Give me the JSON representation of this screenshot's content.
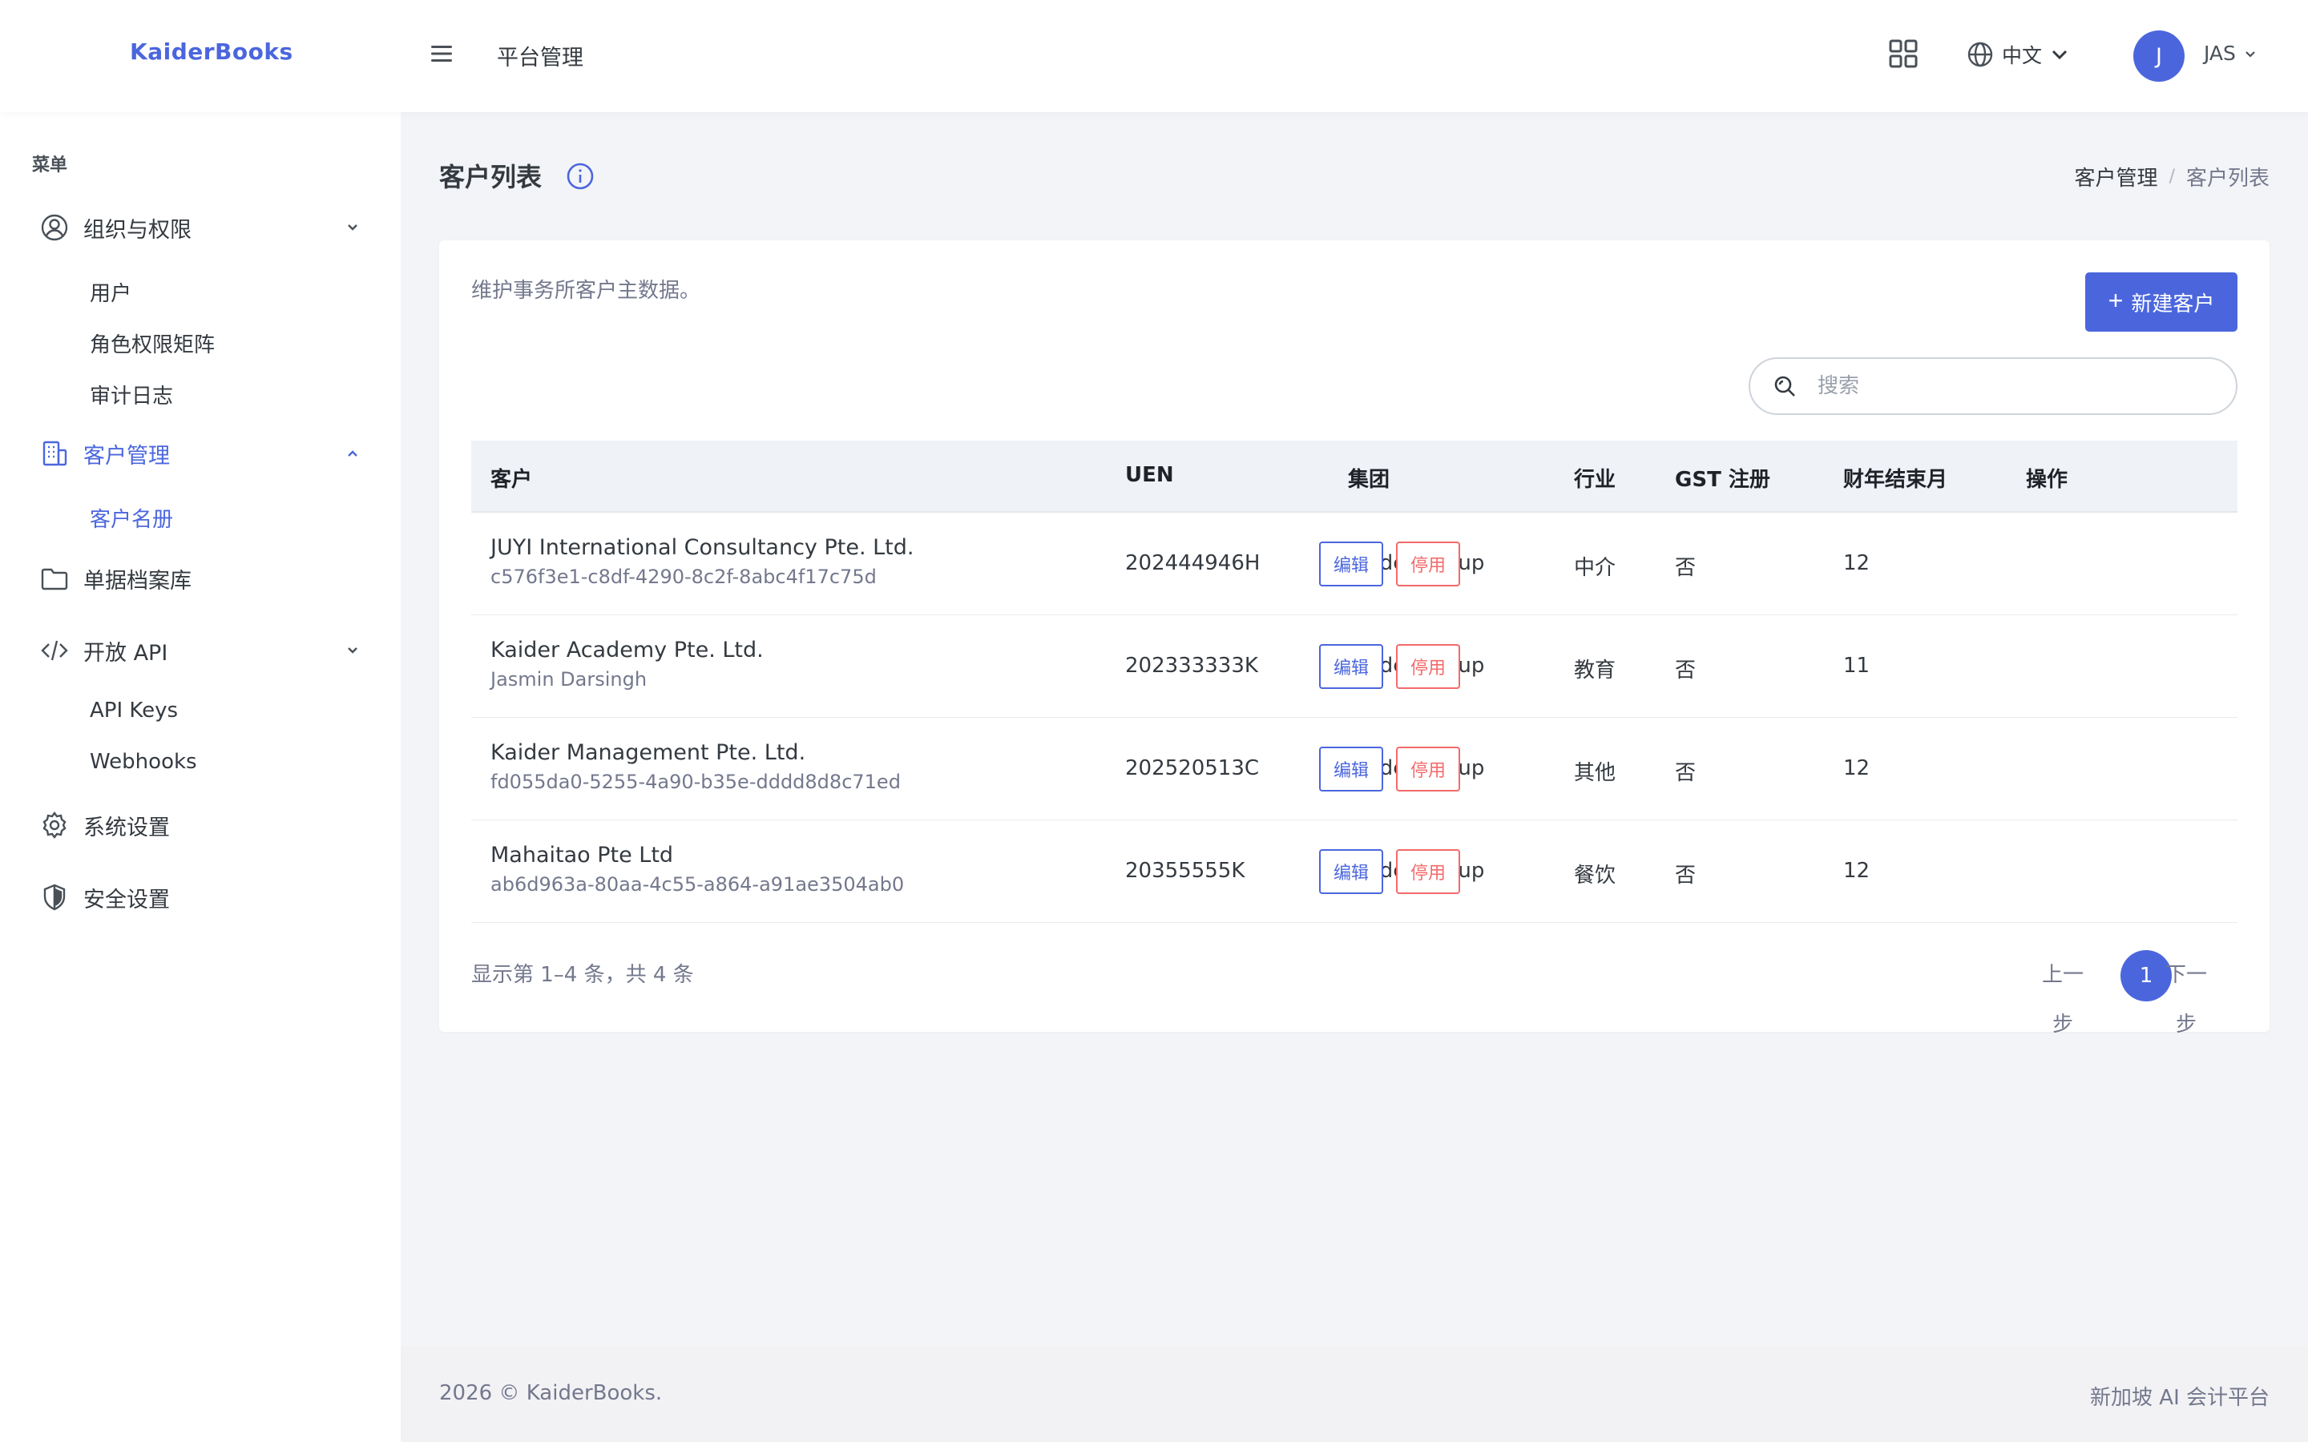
{
  "header": {
    "logo": "KaiderBooks",
    "title": "平台管理",
    "language": "中文",
    "avatar_letter": "J",
    "user": "JAS"
  },
  "sidebar": {
    "menu_title": "菜单",
    "groups": [
      {
        "label": "组织与权限",
        "icon": "user-circle-icon",
        "items": [
          "用户",
          "角色权限矩阵",
          "审计日志"
        ]
      },
      {
        "label": "客户管理",
        "icon": "building-icon",
        "active": true,
        "items": [
          "客户名册"
        ]
      },
      {
        "label": "单据档案库",
        "icon": "folder-icon"
      },
      {
        "label": "开放 API",
        "icon": "code-icon",
        "items": [
          "API Keys",
          "Webhooks"
        ]
      },
      {
        "label": "系统设置",
        "icon": "gear-icon"
      },
      {
        "label": "安全设置",
        "icon": "shield-icon"
      }
    ]
  },
  "page": {
    "title": "客户列表",
    "breadcrumb": [
      "客户管理",
      "客户列表"
    ],
    "description": "维护事务所客户主数据。",
    "new_button": "新建客户",
    "search_placeholder": "搜索"
  },
  "table": {
    "columns": [
      "客户",
      "UEN",
      "集团",
      "行业",
      "GST 注册",
      "财年结束月",
      "操作"
    ],
    "rows": [
      {
        "name": "JUYI International Consultancy Pte. Ltd.",
        "sub": "c576f3e1-c8df-4290-8c2f-8abc4f17c75d",
        "uen": "202444946H",
        "group": "Kaider Group",
        "industry": "中介",
        "gst": "否",
        "fye": "12"
      },
      {
        "name": "Kaider Academy Pte. Ltd.",
        "sub": "Jasmin Darsingh",
        "uen": "202333333K",
        "group": "Kaider Group",
        "industry": "教育",
        "gst": "否",
        "fye": "11"
      },
      {
        "name": "Kaider Management Pte. Ltd.",
        "sub": "fd055da0-5255-4a90-b35e-dddd8d8c71ed",
        "uen": "202520513C",
        "group": "Kaider Group",
        "industry": "其他",
        "gst": "否",
        "fye": "12"
      },
      {
        "name": "Mahaitao Pte Ltd",
        "sub": "ab6d963a-80aa-4c55-a864-a91ae3504ab0",
        "uen": "20355555K",
        "group": "Kaider Group",
        "industry": "餐饮",
        "gst": "否",
        "fye": "12"
      }
    ],
    "edit_label": "编辑",
    "disable_label": "停用"
  },
  "pagination": {
    "summary": "显示第 1–4 条，共 4 条",
    "prev": "上一步",
    "current": "1",
    "next": "下一步"
  },
  "footer": {
    "left": "2026 © KaiderBooks.",
    "right": "新加坡 AI 会计平台"
  },
  "colors": {
    "primary": "#4b66dd",
    "danger": "#f46a6a"
  }
}
